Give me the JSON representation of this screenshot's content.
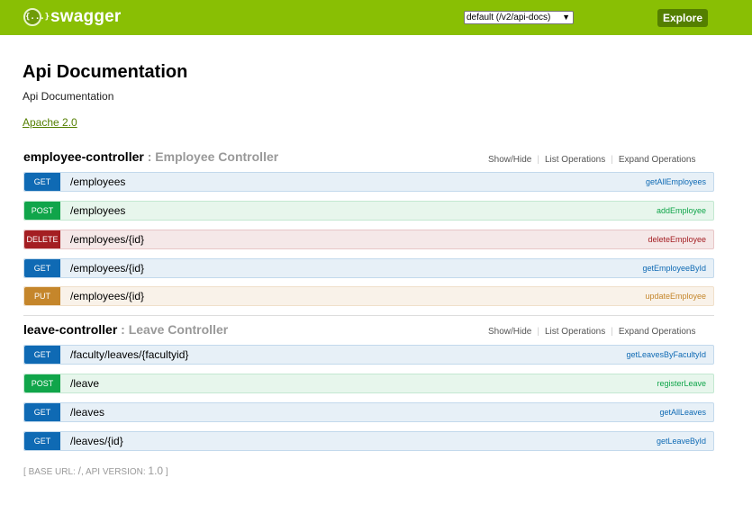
{
  "header": {
    "logo_icon": "{...}",
    "logo_text": "swagger",
    "spec_select": "default (/v2/api-docs)",
    "explore_label": "Explore",
    "color": "#89bf04"
  },
  "info": {
    "title": "Api Documentation",
    "description": "Api Documentation",
    "license": "Apache 2.0"
  },
  "resources": [
    {
      "name": "employee-controller",
      "separator": " : ",
      "description": "Employee Controller",
      "links": [
        "Show/Hide",
        "List Operations",
        "Expand Operations"
      ],
      "operations": [
        {
          "method": "GET",
          "path": "/employees",
          "nickname": "getAllEmployees"
        },
        {
          "method": "POST",
          "path": "/employees",
          "nickname": "addEmployee"
        },
        {
          "method": "DELETE",
          "path": "/employees/{id}",
          "nickname": "deleteEmployee"
        },
        {
          "method": "GET",
          "path": "/employees/{id}",
          "nickname": "getEmployeeById"
        },
        {
          "method": "PUT",
          "path": "/employees/{id}",
          "nickname": "updateEmployee"
        }
      ]
    },
    {
      "name": "leave-controller",
      "separator": " : ",
      "description": "Leave Controller",
      "links": [
        "Show/Hide",
        "List Operations",
        "Expand Operations"
      ],
      "operations": [
        {
          "method": "GET",
          "path": "/faculty/leaves/{facultyid}",
          "nickname": "getLeavesByFacultyId"
        },
        {
          "method": "POST",
          "path": "/leave",
          "nickname": "registerLeave"
        },
        {
          "method": "GET",
          "path": "/leaves",
          "nickname": "getAllLeaves"
        },
        {
          "method": "GET",
          "path": "/leaves/{id}",
          "nickname": "getLeaveById"
        }
      ]
    }
  ],
  "footer": {
    "open_bracket": "[",
    "base_url_label": "BASE URL:",
    "base_url": "/",
    "comma": ",",
    "api_version_label": "API VERSION:",
    "api_version": "1.0",
    "close_bracket": "]"
  },
  "method_colors": {
    "GET": "#0f6ab4",
    "POST": "#10a54a",
    "DELETE": "#a41e22",
    "PUT": "#c5862b"
  }
}
